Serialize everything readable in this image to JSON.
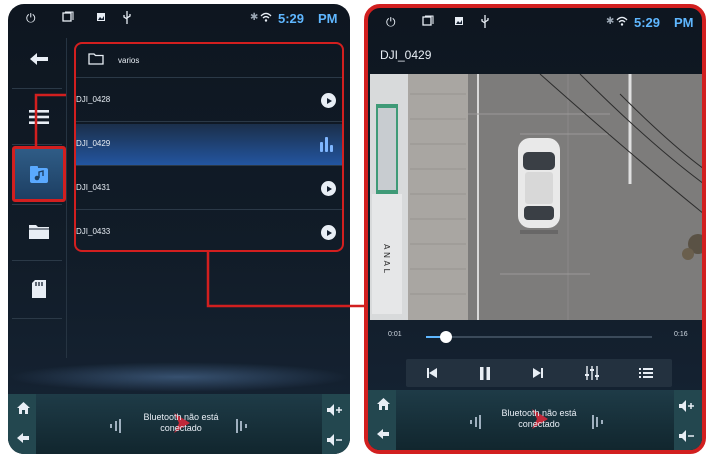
{
  "status": {
    "time": "5:29",
    "ampm": "PM"
  },
  "left": {
    "folder_label": "varios",
    "files": [
      {
        "name": "DJI_0428",
        "state": "play"
      },
      {
        "name": "DJI_0429",
        "state": "playing"
      },
      {
        "name": "DJI_0431",
        "state": "play"
      },
      {
        "name": "DJI_0433",
        "state": "play"
      }
    ]
  },
  "player": {
    "title": "DJI_0429",
    "time_elapsed": "0:01",
    "time_total": "0:16",
    "progress_fraction": 0.09
  },
  "dock": {
    "bt_line1": "Bluetooth não está",
    "bt_line2": "conectado"
  },
  "colors": {
    "highlight": "#d21f1f",
    "accent": "#5fb7ff",
    "panel_bg": "#111c28"
  },
  "icons": [
    "power-icon",
    "window-icon",
    "photo-icon",
    "usb-icon",
    "bluetooth-icon",
    "wifi-icon",
    "back-arrow-icon",
    "menu-icon",
    "music-folder-icon",
    "folder-icon",
    "sd-card-icon",
    "play-icon",
    "equalizer-icon",
    "home-icon",
    "volume-up-icon",
    "volume-down-icon",
    "skip-previous-icon",
    "pause-icon",
    "skip-next-icon",
    "eq-settings-icon",
    "playlist-icon"
  ]
}
